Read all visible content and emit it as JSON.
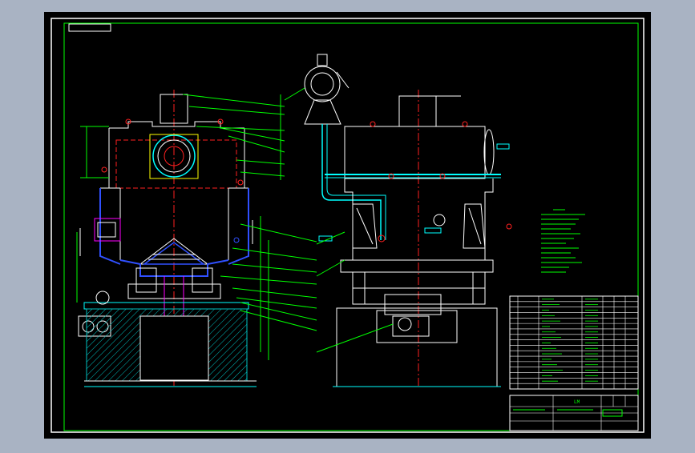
{
  "colors": {
    "background_outer": "#a9b3c3",
    "canvas": "#000000",
    "frame": "#ffffff",
    "border_green": "#00ff00",
    "red": "#ff2020",
    "cyan": "#00ffff",
    "blue": "#3050ff",
    "yellow": "#ffff00",
    "magenta": "#ff00ff",
    "hatch": "#00c0c0"
  },
  "drawing": {
    "title_block_label": "LM"
  }
}
